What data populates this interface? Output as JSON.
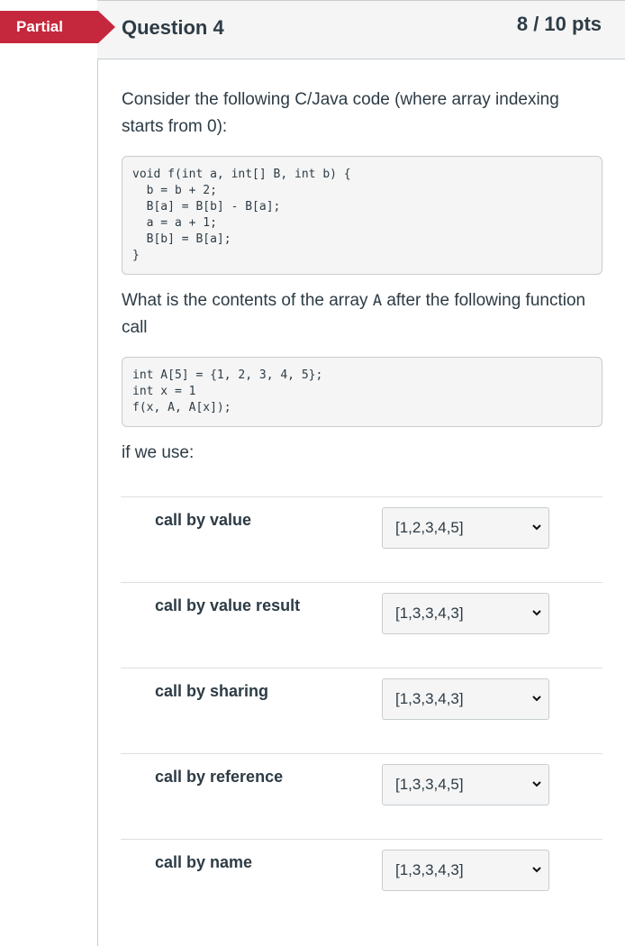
{
  "header": {
    "badge": "Partial",
    "title": "Question 4",
    "points": "8 / 10 pts"
  },
  "question": {
    "intro": "Consider the following C/Java code (where array indexing starts from 0):",
    "code1": "void f(int a, int[] B, int b) {\n  b = b + 2;\n  B[a] = B[b] - B[a];\n  a = a + 1;\n  B[b] = B[a];\n}",
    "prompt_before": "What is the contents of the array ",
    "prompt_var": "A",
    "prompt_after": " after the following function call",
    "code2": "int A[5] = {1, 2, 3, 4, 5};\nint x = 1\nf(x, A, A[x]);",
    "if_we_use": "if we use:"
  },
  "answers": [
    {
      "label": "call by value",
      "selected": "[1,2,3,4,5]"
    },
    {
      "label": "call by value result",
      "selected": "[1,3,3,4,3]"
    },
    {
      "label": "call by sharing",
      "selected": "[1,3,3,4,3]"
    },
    {
      "label": "call by reference",
      "selected": "[1,3,3,4,5]"
    },
    {
      "label": "call by name",
      "selected": "[1,3,3,4,3]"
    }
  ]
}
